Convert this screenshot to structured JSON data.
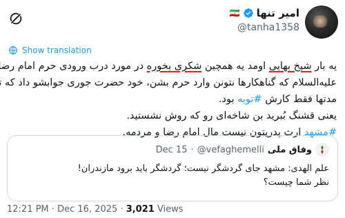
{
  "author": {
    "display_name": "امیر تنها",
    "handle": "@tanha1358",
    "flag": "🇮🇷"
  },
  "translate_label": "Show translation",
  "tweet": {
    "line1_a": "یه بار ",
    "line1_b": "شیخ بهایی",
    "line1_c": " اومد یه همچین ",
    "line1_d": "شکری بخوره",
    "line1_e": " در مورد درب ورودی حرم امام رضا",
    "line2": "علیه‌السلام که گناهکارها نتونن وارد حرم بشن، خود حضرت جوری جوابشو داد که تا",
    "line3_a": "مدتها فقط کارش ",
    "line3_b": "#توبه",
    "line3_c": " بود.",
    "line4": "یعنی قشنگ بُبرید بن شاخه‌ای رو که روش نشستید.",
    "line5_a": "#مشهد",
    "line5_b": " ارث پدریتون نیست مال امام رضا و مردمه."
  },
  "quote": {
    "name": "وفاق ملی",
    "handle": "@vefaghemelli",
    "separator": "·",
    "date": "Dec 15",
    "line1": "علم الهدی: مشهد جای گردشگر نیست؛ گردشگر باید برود مازندران!",
    "line2": "نظر شما چیست؟"
  },
  "meta": {
    "time": "12:21 PM",
    "separator": "·",
    "date": "Dec 16, 2025",
    "views_count": "3,021",
    "views_label": "Views"
  },
  "colors": {
    "accent": "#1d9bf0",
    "underline": "#e0201c",
    "muted": "#536471"
  },
  "icons": [
    "grok-icon",
    "verified-badge-icon",
    "translate-globe-icon"
  ]
}
